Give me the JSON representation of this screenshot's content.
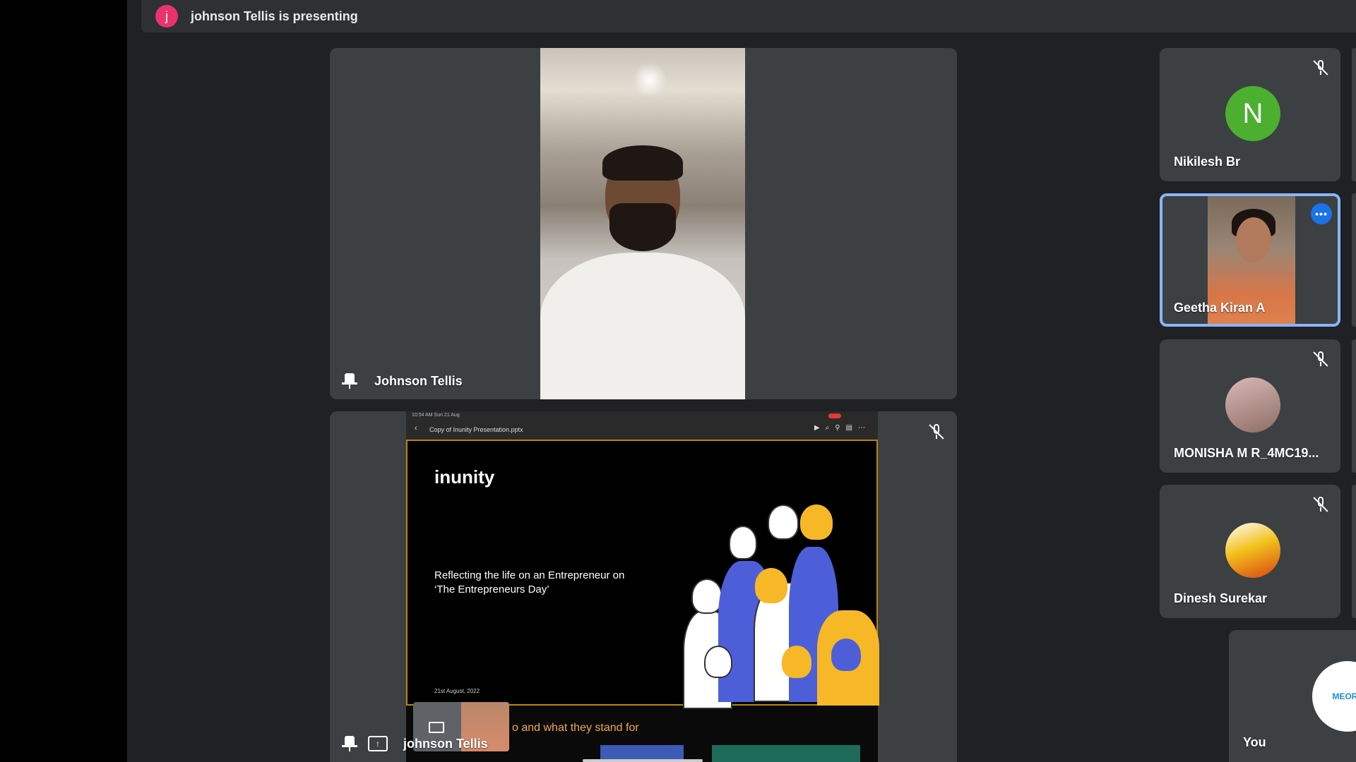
{
  "banner": {
    "avatar_letter": "j",
    "text": "johnson Tellis is presenting"
  },
  "main_tile": {
    "name": "Johnson Tellis"
  },
  "share_tile": {
    "name": "johnson Tellis",
    "status_bar": "10:54 AM  Sun 21 Aug",
    "doc_title": "Copy of Inunity Presentation.pptx",
    "slide": {
      "logo": "inunity",
      "line1": "Reflecting the life on an Entrepreneur on",
      "line2": "‘The Entrepreneurs Day’",
      "date": "21st August, 2022"
    },
    "subtitle": "o and what they stand for"
  },
  "participants": [
    {
      "name": "Nikilesh Br",
      "initial": "N",
      "avatar_color": "#4caf2f",
      "muted": true
    },
    {
      "name": "Geetha Kiran A",
      "speaking": true,
      "muted": false
    },
    {
      "name": "MONISHA M R_4MC19...",
      "muted": true
    },
    {
      "name": "Dinesh Surekar",
      "muted": true
    }
  ],
  "self_tile": {
    "name": "You",
    "avatar_text": "MEORT"
  },
  "colors": {
    "stage_bg": "#202124",
    "tile_bg": "#3c4043",
    "active_border": "#8ab4f8",
    "banner_avatar": "#e8336d",
    "subtitle": "#f1a84a"
  }
}
